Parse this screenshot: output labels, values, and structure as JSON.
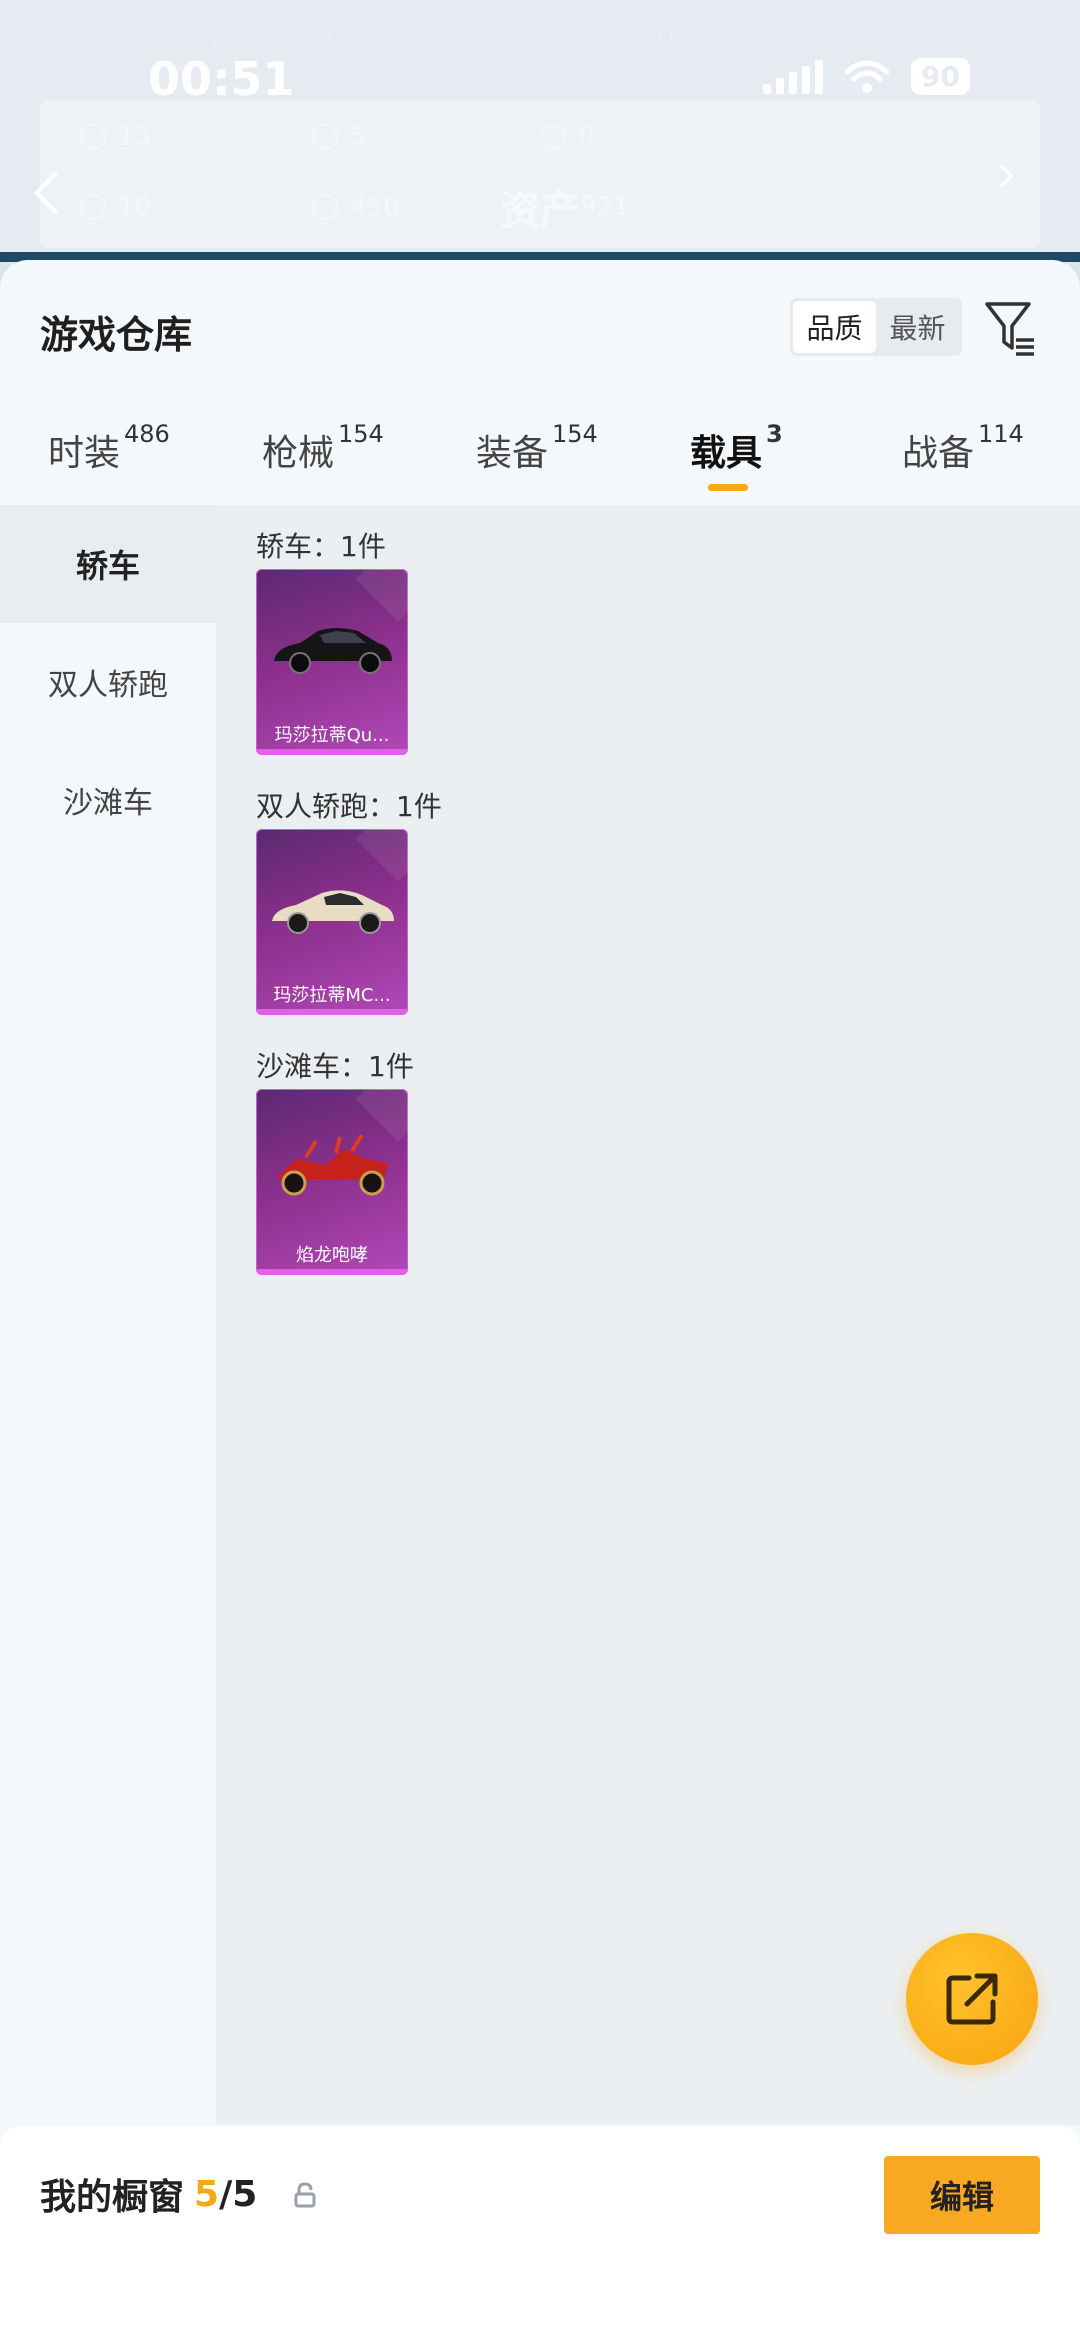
{
  "status_bar": {
    "time": "00:51",
    "battery": "90"
  },
  "header_bg": {
    "level": "53级",
    "coins": "34083",
    "score": "46786",
    "stats_row1": [
      "13",
      "5",
      "0"
    ],
    "stats_row2": [
      "10",
      "450"
    ],
    "assets_label": "资产",
    "assets_value": "921"
  },
  "sheet": {
    "title": "游戏仓库",
    "sort": {
      "quality": "品质",
      "latest": "最新"
    },
    "tabs": [
      {
        "label": "时装",
        "count": "486"
      },
      {
        "label": "枪械",
        "count": "154"
      },
      {
        "label": "装备",
        "count": "154"
      },
      {
        "label": "载具",
        "count": "3"
      },
      {
        "label": "战备",
        "count": "114"
      }
    ],
    "side_nav": [
      "轿车",
      "双人轿跑",
      "沙滩车"
    ],
    "sections": [
      {
        "title": "轿车：1件",
        "item": "玛莎拉蒂Qu..."
      },
      {
        "title": "双人轿跑：1件",
        "item": "玛莎拉蒂MC..."
      },
      {
        "title": "沙滩车：1件",
        "item": "焰龙咆哮"
      }
    ]
  },
  "bottom_bar": {
    "label": "我的橱窗",
    "count_current": "5",
    "count_total": "/5",
    "edit": "编辑"
  },
  "colors": {
    "accent": "#f8a921",
    "card_purple": "#8b2f8c"
  }
}
